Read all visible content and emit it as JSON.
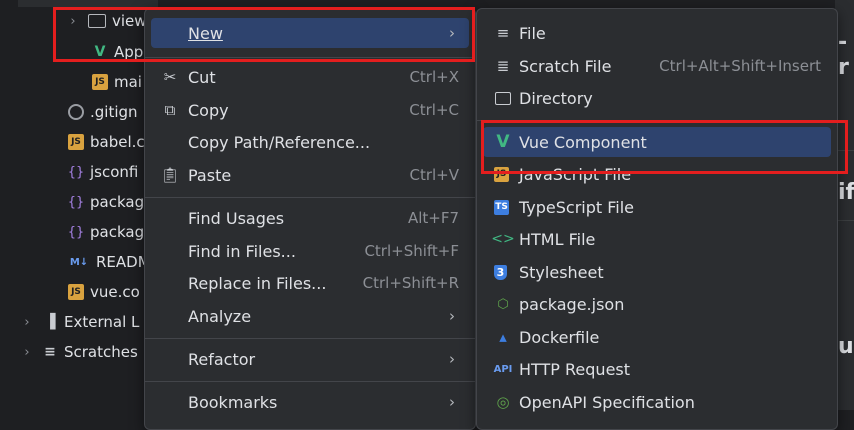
{
  "tree": {
    "items": [
      {
        "name": "view",
        "icon": "folder-icon"
      },
      {
        "name": "App",
        "icon": "vue-icon"
      },
      {
        "name": "mai",
        "icon": "js-icon"
      },
      {
        "name": ".gitign",
        "icon": "ignore-icon"
      },
      {
        "name": "babel.c",
        "icon": "js-icon"
      },
      {
        "name": "jsconfi",
        "icon": "json-icon"
      },
      {
        "name": "packag",
        "icon": "json-icon"
      },
      {
        "name": "packag",
        "icon": "json-icon"
      },
      {
        "name": "READM",
        "icon": "markdown-icon",
        "badge": "M↓"
      },
      {
        "name": "vue.co",
        "icon": "js-icon"
      },
      {
        "name": "External L",
        "icon": "library-icon"
      },
      {
        "name": "Scratches",
        "icon": "scratches-icon"
      }
    ]
  },
  "editor": {
    "fragments": [
      "-r",
      "if",
      "ur"
    ]
  },
  "context_menu": {
    "items": [
      {
        "label": "New",
        "shortcut": "",
        "submenu": true
      },
      {
        "label": "Cut",
        "shortcut": "Ctrl+X",
        "icon": "scissors-icon"
      },
      {
        "label": "Copy",
        "shortcut": "Ctrl+C",
        "icon": "copy-icon"
      },
      {
        "label": "Copy Path/Reference...",
        "shortcut": ""
      },
      {
        "label": "Paste",
        "shortcut": "Ctrl+V",
        "icon": "clipboard-icon"
      },
      {
        "label": "Find Usages",
        "shortcut": "Alt+F7"
      },
      {
        "label": "Find in Files...",
        "shortcut": "Ctrl+Shift+F"
      },
      {
        "label": "Replace in Files...",
        "shortcut": "Ctrl+Shift+R"
      },
      {
        "label": "Analyze",
        "shortcut": "",
        "submenu": true
      },
      {
        "label": "Refactor",
        "shortcut": "",
        "submenu": true
      },
      {
        "label": "Bookmarks",
        "shortcut": "",
        "submenu": true
      }
    ]
  },
  "new_submenu": {
    "items": [
      {
        "label": "File",
        "shortcut": "",
        "icon": "file-lines-icon"
      },
      {
        "label": "Scratch File",
        "shortcut": "Ctrl+Alt+Shift+Insert",
        "icon": "scratch-file-icon"
      },
      {
        "label": "Directory",
        "shortcut": "",
        "icon": "folder-icon"
      },
      {
        "label": "Vue Component",
        "shortcut": "",
        "icon": "vue-icon"
      },
      {
        "label": "JavaScript File",
        "shortcut": "",
        "icon": "javascript-icon",
        "badge": "JS"
      },
      {
        "label": "TypeScript File",
        "shortcut": "",
        "icon": "typescript-icon",
        "badge": "TS"
      },
      {
        "label": "HTML File",
        "shortcut": "",
        "icon": "html-icon"
      },
      {
        "label": "Stylesheet",
        "shortcut": "",
        "icon": "css-icon",
        "badge": "3"
      },
      {
        "label": "package.json",
        "shortcut": "",
        "icon": "nodejs-icon"
      },
      {
        "label": "Dockerfile",
        "shortcut": "",
        "icon": "docker-icon"
      },
      {
        "label": "HTTP Request",
        "shortcut": "",
        "icon": "api-icon",
        "badge": "API"
      },
      {
        "label": "OpenAPI Specification",
        "shortcut": "",
        "icon": "openapi-icon"
      }
    ]
  },
  "colors": {
    "accent_selection": "#2e436e",
    "highlight_box": "#e41e1e",
    "menu_background": "#2b2d30",
    "vue_green": "#41b883"
  }
}
